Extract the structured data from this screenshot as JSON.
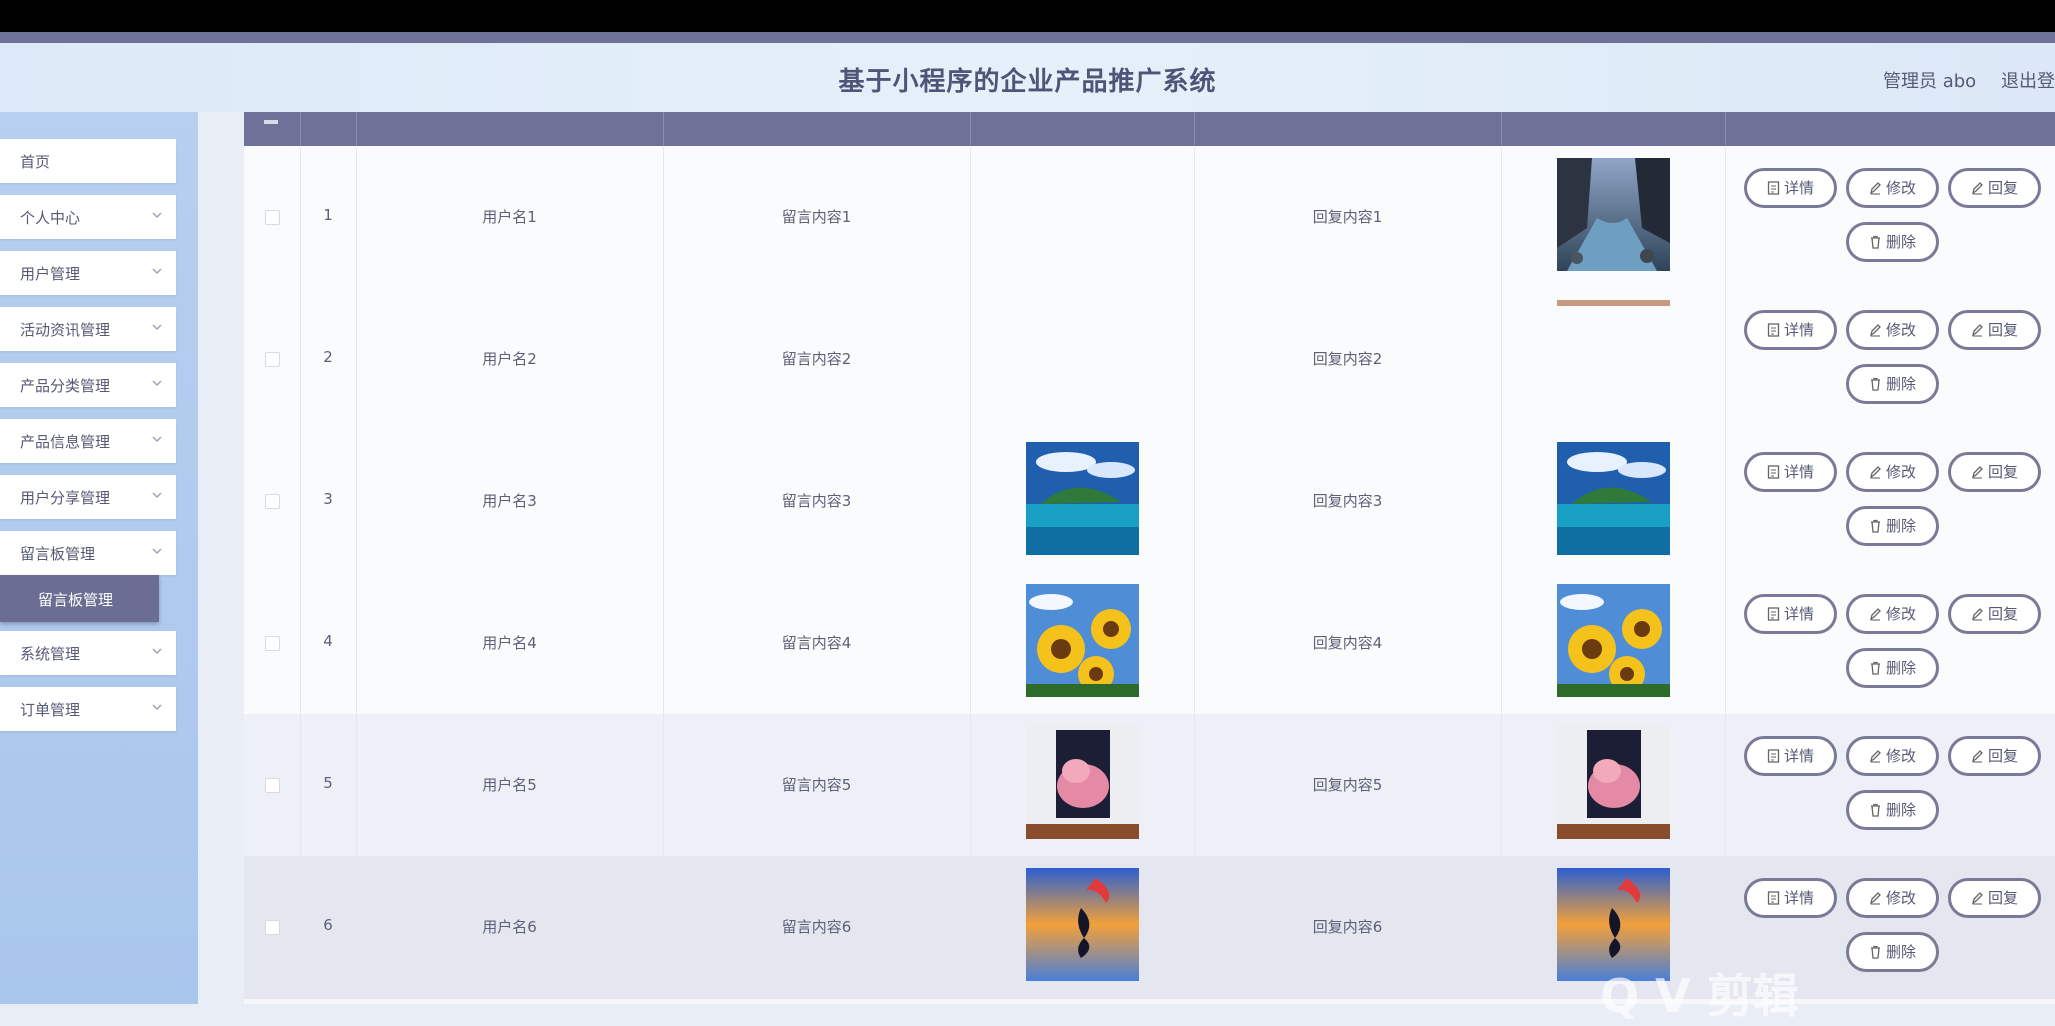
{
  "header": {
    "title": "基于小程序的企业产品推广系统",
    "admin": "管理员 abo",
    "logout": "退出登"
  },
  "sidebar": {
    "items": [
      {
        "label": "首页"
      },
      {
        "label": "个人中心"
      },
      {
        "label": "用户管理"
      },
      {
        "label": "活动资讯管理"
      },
      {
        "label": "产品分类管理"
      },
      {
        "label": "产品信息管理"
      },
      {
        "label": "用户分享管理"
      },
      {
        "label": "留言板管理"
      },
      {
        "label": "系统管理"
      },
      {
        "label": "订单管理"
      }
    ],
    "submenu_active": "留言板管理"
  },
  "buttons": {
    "detail": "详情",
    "edit": "修改",
    "reply": "回复",
    "delete": "删除"
  },
  "rows": [
    {
      "index": "1",
      "username": "用户名1",
      "message": "留言内容1",
      "reply": "回复内容1",
      "image": "",
      "reply_image": "river-canyon"
    },
    {
      "index": "2",
      "username": "用户名2",
      "message": "留言内容2",
      "reply": "回复内容2",
      "image": "",
      "reply_image": "partial-strip"
    },
    {
      "index": "3",
      "username": "用户名3",
      "message": "留言内容3",
      "reply": "回复内容3",
      "image": "tropical-island",
      "reply_image": "tropical-island"
    },
    {
      "index": "4",
      "username": "用户名4",
      "message": "留言内容4",
      "reply": "回复内容4",
      "image": "sunflowers",
      "reply_image": "sunflowers"
    },
    {
      "index": "5",
      "username": "用户名5",
      "message": "留言内容5",
      "reply": "回复内容5",
      "image": "pink-cloud-painting",
      "reply_image": "pink-cloud-painting"
    },
    {
      "index": "6",
      "username": "用户名6",
      "message": "留言内容6",
      "reply": "回复内容6",
      "image": "sunset-dolphin",
      "reply_image": "sunset-dolphin"
    }
  ],
  "colors": {
    "accent": "#6f7298",
    "sidebar": "#b7cff0",
    "button_border": "#7a7a98"
  },
  "watermark": "Q V 剪辑"
}
